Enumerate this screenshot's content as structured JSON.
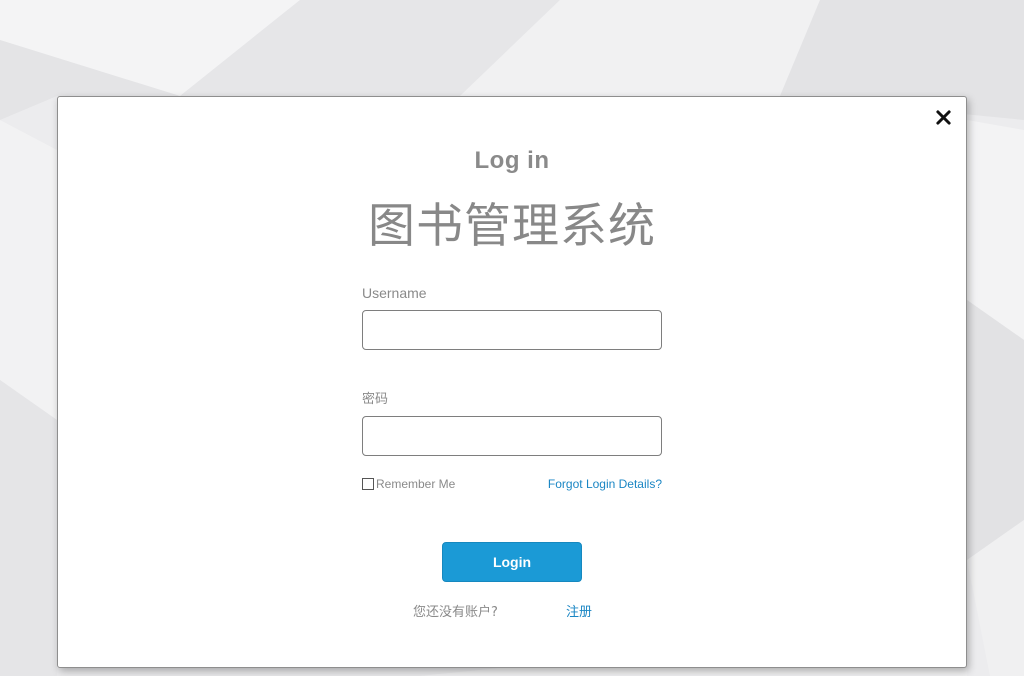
{
  "modal": {
    "heading": "Log in",
    "app_title": "图书管理系统",
    "close_icon": "close-icon"
  },
  "form": {
    "username_label": "Username",
    "username_value": "",
    "username_placeholder": "",
    "password_label": "密码",
    "password_value": "",
    "password_placeholder": "",
    "remember_label": "Remember Me",
    "remember_checked": false,
    "forgot_link": "Forgot Login Details?",
    "login_button": "Login",
    "no_account_text": "您还没有账户?",
    "register_link": "注册"
  },
  "colors": {
    "accent": "#1b9ad6",
    "link": "#1a86c4",
    "text_muted": "#8a8a8a",
    "background": "#ececee"
  }
}
